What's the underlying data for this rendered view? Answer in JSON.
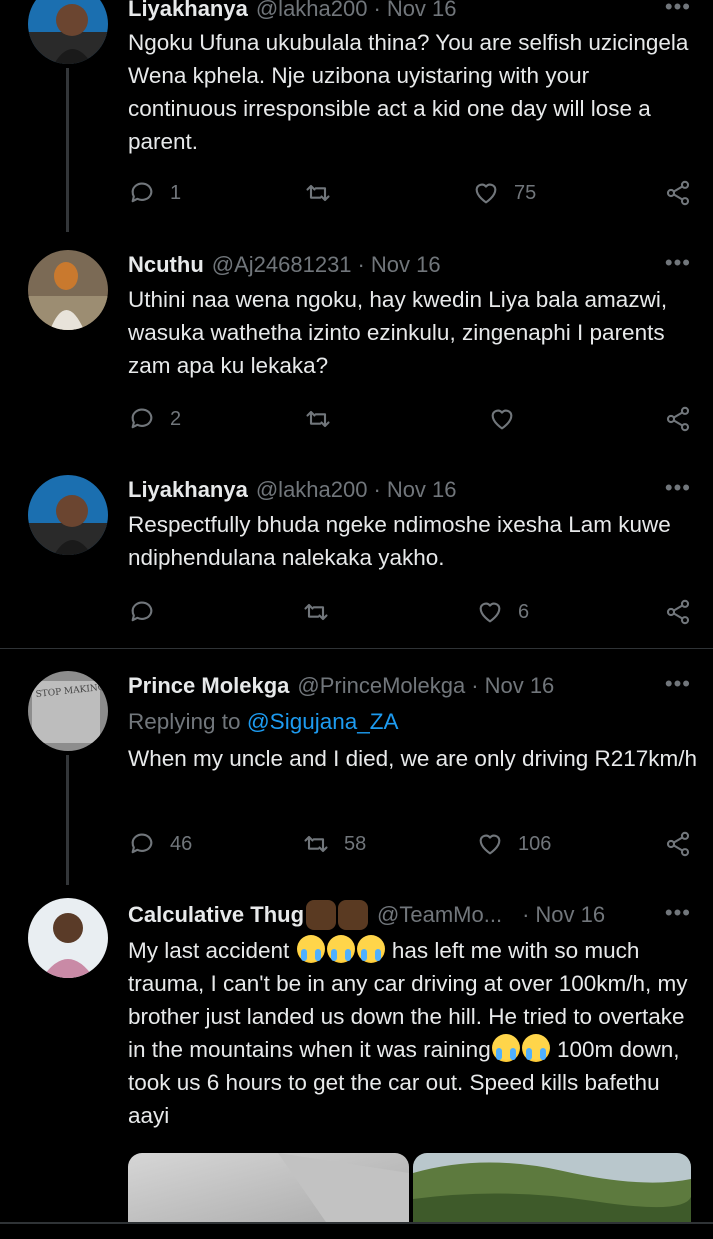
{
  "tweets": [
    {
      "name": "Liyakhanya",
      "handle": "@lakha200",
      "date": "Nov 16",
      "text": "Ngoku Ufuna ukubulala thina? You are selfish uzicingela Wena kphela. Nje uzibona uyistaring with your continuous irresponsible act a kid one day will lose a parent.",
      "replies": "1",
      "retweets": "",
      "likes": "75"
    },
    {
      "name": "Ncuthu",
      "handle": "@Aj24681231",
      "date": "Nov 16",
      "text": "Uthini naa wena ngoku, hay kwedin Liya bala amazwi, wasuka wathetha izinto ezinkulu, zingenaphi I parents zam apa ku lekaka?",
      "replies": "2",
      "retweets": "",
      "likes": ""
    },
    {
      "name": "Liyakhanya",
      "handle": "@lakha200",
      "date": "Nov 16",
      "text": "Respectfully bhuda ngeke ndimoshe ixesha Lam kuwe ndiphendulana nalekaka yakho.",
      "replies": "",
      "retweets": "",
      "likes": "6"
    },
    {
      "name": "Prince Molekga",
      "handle": "@PrinceMolekga",
      "date": "Nov 16",
      "replying_label": "Replying to",
      "replying_to": "@Sigujana_ZA",
      "text": "When my uncle and I died, we are only driving R217km/h",
      "replies": "46",
      "retweets": "58",
      "likes": "106",
      "avatar_sign": "STOP MAKING STUPID PEOPLE FAMOUS"
    },
    {
      "name": "Calculative Thug",
      "handle": "@TeamMo...",
      "date": "Nov 16",
      "text_1": "My last accident",
      "text_2": "has left me with so much trauma, I can't be in any car driving at over 100km/h, my brother just landed us down the hill. He tried to overtake in the mountains when it was raining",
      "text_3": "100m down, took us 6 hours to get the car out. Speed kills bafethu aayi"
    }
  ],
  "more_glyph": "•••",
  "dot_glyph": "·",
  "icons": {
    "reply": "reply-icon",
    "retweet": "retweet-icon",
    "like": "heart-icon",
    "share": "share-icon",
    "more": "more-icon"
  },
  "colors": {
    "background": "#000000",
    "text": "#e7e9ea",
    "muted": "#71767b",
    "link": "#1d9bf0",
    "divider": "#2f3336"
  }
}
